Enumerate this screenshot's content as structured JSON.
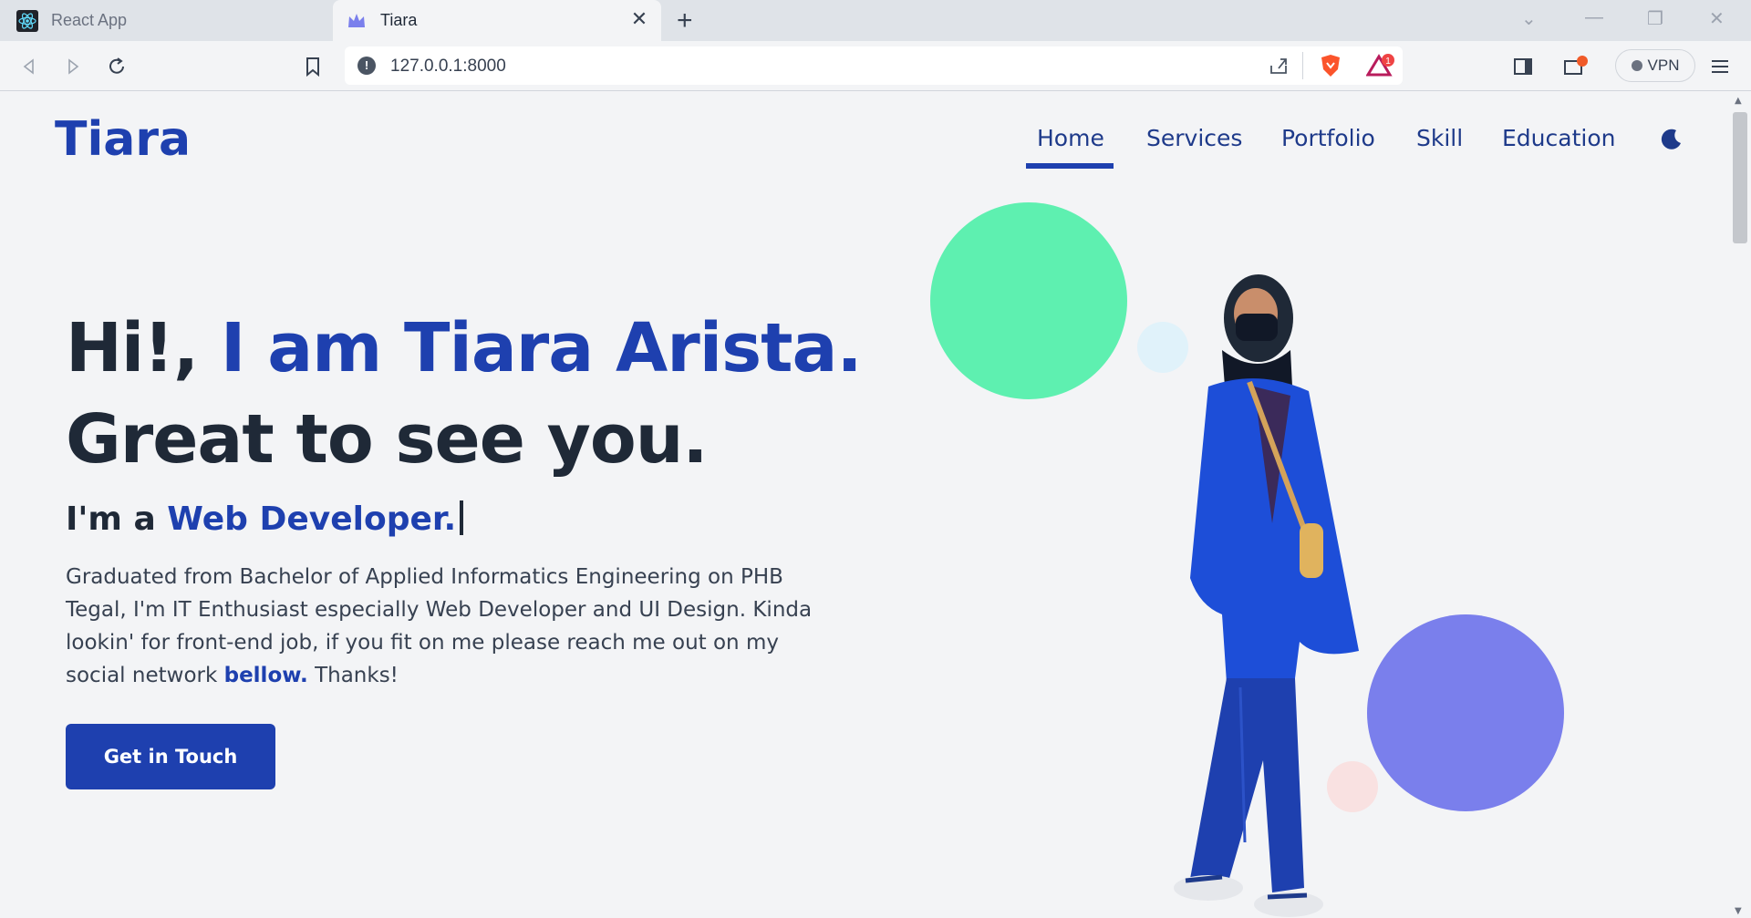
{
  "browser": {
    "tabs": [
      {
        "label": "React App"
      },
      {
        "label": "Tiara"
      }
    ],
    "url": "127.0.0.1:8000",
    "vpn_label": "VPN",
    "notification_count": "1"
  },
  "site": {
    "logo": "Tiara",
    "nav": [
      "Home",
      "Services",
      "Portfolio",
      "Skill",
      "Education"
    ],
    "active_nav": "Home"
  },
  "hero": {
    "line1_prefix": "Hi!, ",
    "line1_name": "I am Tiara Arista.",
    "line2": "Great to see you.",
    "role_prefix": "I'm a ",
    "role": "Web Developer.",
    "description_main": "Graduated from Bachelor of Applied Informatics Engineering on PHB Tegal, I'm IT Enthusiast especially Web Developer and UI Design. Kinda lookin' for front-end job, if you fit on me please reach me out on my social network ",
    "description_emph": "bellow.",
    "description_end": " Thanks!",
    "cta_label": "Get in Touch"
  },
  "colors": {
    "accent": "#1e40af",
    "circle_green": "#5ef0b0",
    "circle_purple": "#7a7fec",
    "circle_light_blue": "#e0f2fa",
    "circle_pink": "#f9e1e1"
  }
}
